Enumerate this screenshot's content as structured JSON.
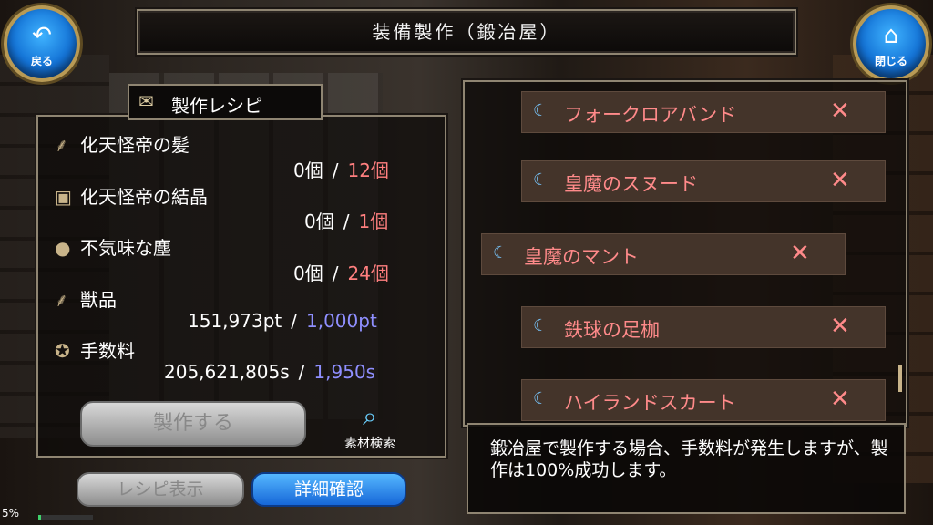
{
  "title": "装備製作（鍛冶屋）",
  "nav": {
    "back_label": "戻る",
    "back_icon": "undo-arrow-icon",
    "close_label": "閉じる",
    "close_icon": "home-icon"
  },
  "recipe": {
    "header": "製作レシピ",
    "materials": [
      {
        "name": "化天怪帝の髪",
        "icon": "feather-icon",
        "have": "0個",
        "need": "12個"
      },
      {
        "name": "化天怪帝の結晶",
        "icon": "chest-icon",
        "have": "0個",
        "need": "1個"
      },
      {
        "name": "不気味な塵",
        "icon": "pouch-icon",
        "have": "0個",
        "need": "24個"
      },
      {
        "name": "獣品",
        "icon": "feather-icon",
        "have": "151,973pt",
        "need": "1,000pt"
      },
      {
        "name": "手数料",
        "icon": "coins-icon",
        "have": "205,621,805s",
        "need": "1,950s"
      }
    ],
    "separator": "/",
    "craft_button": "製作する",
    "search_label": "素材検索",
    "recipe_view_button": "レシピ表示",
    "detail_button": "詳細確認"
  },
  "equipment_list": [
    {
      "name": "フォークロアバンド",
      "remove": "✕",
      "selected": false
    },
    {
      "name": "皇魔のスヌード",
      "remove": "✕",
      "selected": false
    },
    {
      "name": "皇魔のマント",
      "remove": "✕",
      "selected": true
    },
    {
      "name": "鉄球の足枷",
      "remove": "✕",
      "selected": false
    },
    {
      "name": "ハイランドスカート",
      "remove": "✕",
      "selected": false
    }
  ],
  "message": "鍛冶屋で製作する場合、手数料が発生しますが、製作は100%成功します。",
  "status": {
    "percent_text": "5%",
    "progress": 0.05
  },
  "colors": {
    "need_red": "#ff7f7f",
    "need_blue": "#8f8fff",
    "item_text": "#ff8a8a",
    "button_blue": "#1667d8"
  }
}
